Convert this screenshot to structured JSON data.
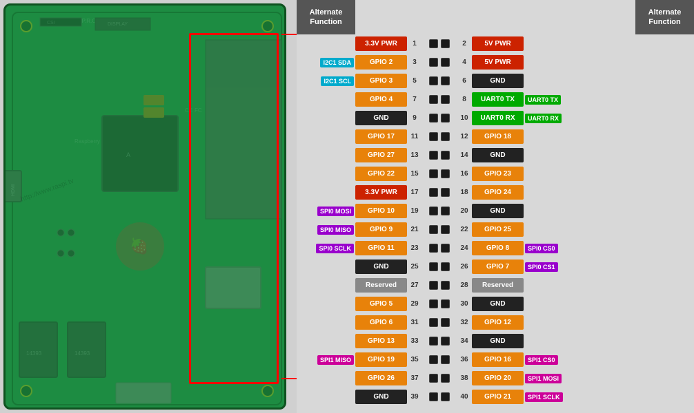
{
  "header": {
    "left": "Alternate\nFunction",
    "right": "Alternate\nFunction"
  },
  "pins": [
    {
      "num_l": "1",
      "label_l": "3.3V PWR",
      "color_l": "c-red",
      "num_r": "2",
      "label_r": "5V PWR",
      "color_r": "c-red",
      "alt_l": "",
      "alt_r": "",
      "color_alt_l": "",
      "color_alt_r": ""
    },
    {
      "num_l": "3",
      "label_l": "GPIO 2",
      "color_l": "c-orange",
      "num_r": "4",
      "label_r": "5V PWR",
      "color_r": "c-red",
      "alt_l": "I2C1 SDA",
      "alt_r": "",
      "color_alt_l": "c-cyan",
      "color_alt_r": ""
    },
    {
      "num_l": "5",
      "label_l": "GPIO 3",
      "color_l": "c-orange",
      "num_r": "6",
      "label_r": "GND",
      "color_r": "c-black",
      "alt_l": "I2C1 SCL",
      "alt_r": "",
      "color_alt_l": "c-cyan",
      "color_alt_r": ""
    },
    {
      "num_l": "7",
      "label_l": "GPIO 4",
      "color_l": "c-orange",
      "num_r": "8",
      "label_r": "UART0 TX",
      "color_r": "c-green",
      "alt_l": "",
      "alt_r": "UART0 TX",
      "color_alt_l": "",
      "color_alt_r": "c-green"
    },
    {
      "num_l": "9",
      "label_l": "GND",
      "color_l": "c-black",
      "num_r": "10",
      "label_r": "UART0 RX",
      "color_r": "c-green",
      "alt_l": "",
      "alt_r": "UART0 RX",
      "color_alt_l": "",
      "color_alt_r": "c-green"
    },
    {
      "num_l": "11",
      "label_l": "GPIO 17",
      "color_l": "c-orange",
      "num_r": "12",
      "label_r": "GPIO 18",
      "color_r": "c-orange",
      "alt_l": "",
      "alt_r": "",
      "color_alt_l": "",
      "color_alt_r": ""
    },
    {
      "num_l": "13",
      "label_l": "GPIO 27",
      "color_l": "c-orange",
      "num_r": "14",
      "label_r": "GND",
      "color_r": "c-black",
      "alt_l": "",
      "alt_r": "",
      "color_alt_l": "",
      "color_alt_r": ""
    },
    {
      "num_l": "15",
      "label_l": "GPIO 22",
      "color_l": "c-orange",
      "num_r": "16",
      "label_r": "GPIO 23",
      "color_r": "c-orange",
      "alt_l": "",
      "alt_r": "",
      "color_alt_l": "",
      "color_alt_r": ""
    },
    {
      "num_l": "17",
      "label_l": "3.3V PWR",
      "color_l": "c-red",
      "num_r": "18",
      "label_r": "GPIO 24",
      "color_r": "c-orange",
      "alt_l": "",
      "alt_r": "",
      "color_alt_l": "",
      "color_alt_r": ""
    },
    {
      "num_l": "19",
      "label_l": "GPIO 10",
      "color_l": "c-orange",
      "num_r": "20",
      "label_r": "GND",
      "color_r": "c-black",
      "alt_l": "SPI0 MOSI",
      "alt_r": "",
      "color_alt_l": "c-purple",
      "color_alt_r": ""
    },
    {
      "num_l": "21",
      "label_l": "GPIO 9",
      "color_l": "c-orange",
      "num_r": "22",
      "label_r": "GPIO 25",
      "color_r": "c-orange",
      "alt_l": "SPI0 MISO",
      "alt_r": "",
      "color_alt_l": "c-purple",
      "color_alt_r": ""
    },
    {
      "num_l": "23",
      "label_l": "GPIO 11",
      "color_l": "c-orange",
      "num_r": "24",
      "label_r": "GPIO 8",
      "color_r": "c-orange",
      "alt_l": "SPI0 SCLK",
      "alt_r": "SPI0 CS0",
      "color_alt_l": "c-purple",
      "color_alt_r": "c-purple"
    },
    {
      "num_l": "25",
      "label_l": "GND",
      "color_l": "c-black",
      "num_r": "26",
      "label_r": "GPIO 7",
      "color_r": "c-orange",
      "alt_l": "",
      "alt_r": "SPI0 CS1",
      "color_alt_l": "",
      "color_alt_r": "c-purple"
    },
    {
      "num_l": "27",
      "label_l": "Reserved",
      "color_l": "c-gray",
      "num_r": "28",
      "label_r": "Reserved",
      "color_r": "c-gray",
      "alt_l": "",
      "alt_r": "",
      "color_alt_l": "",
      "color_alt_r": ""
    },
    {
      "num_l": "29",
      "label_l": "GPIO 5",
      "color_l": "c-orange",
      "num_r": "30",
      "label_r": "GND",
      "color_r": "c-black",
      "alt_l": "",
      "alt_r": "",
      "color_alt_l": "",
      "color_alt_r": ""
    },
    {
      "num_l": "31",
      "label_l": "GPIO 6",
      "color_l": "c-orange",
      "num_r": "32",
      "label_r": "GPIO 12",
      "color_r": "c-orange",
      "alt_l": "",
      "alt_r": "",
      "color_alt_l": "",
      "color_alt_r": ""
    },
    {
      "num_l": "33",
      "label_l": "GPIO 13",
      "color_l": "c-orange",
      "num_r": "34",
      "label_r": "GND",
      "color_r": "c-black",
      "alt_l": "",
      "alt_r": "",
      "color_alt_l": "",
      "color_alt_r": ""
    },
    {
      "num_l": "35",
      "label_l": "GPIO 19",
      "color_l": "c-orange",
      "num_r": "36",
      "label_r": "GPIO 16",
      "color_r": "c-orange",
      "alt_l": "SPI1 MISO",
      "alt_r": "SPI1 CS0",
      "color_alt_l": "c-pink",
      "color_alt_r": "c-pink"
    },
    {
      "num_l": "37",
      "label_l": "GPIO 26",
      "color_l": "c-orange",
      "num_r": "38",
      "label_r": "GPIO 20",
      "color_r": "c-orange",
      "alt_l": "",
      "alt_r": "SPI1 MOSI",
      "color_alt_l": "",
      "color_alt_r": "c-pink"
    },
    {
      "num_l": "39",
      "label_l": "GND",
      "color_l": "c-black",
      "num_r": "40",
      "label_r": "GPIO 21",
      "color_r": "c-orange",
      "alt_l": "",
      "alt_r": "SPI1 SCLK",
      "color_alt_l": "",
      "color_alt_r": "c-pink"
    }
  ]
}
